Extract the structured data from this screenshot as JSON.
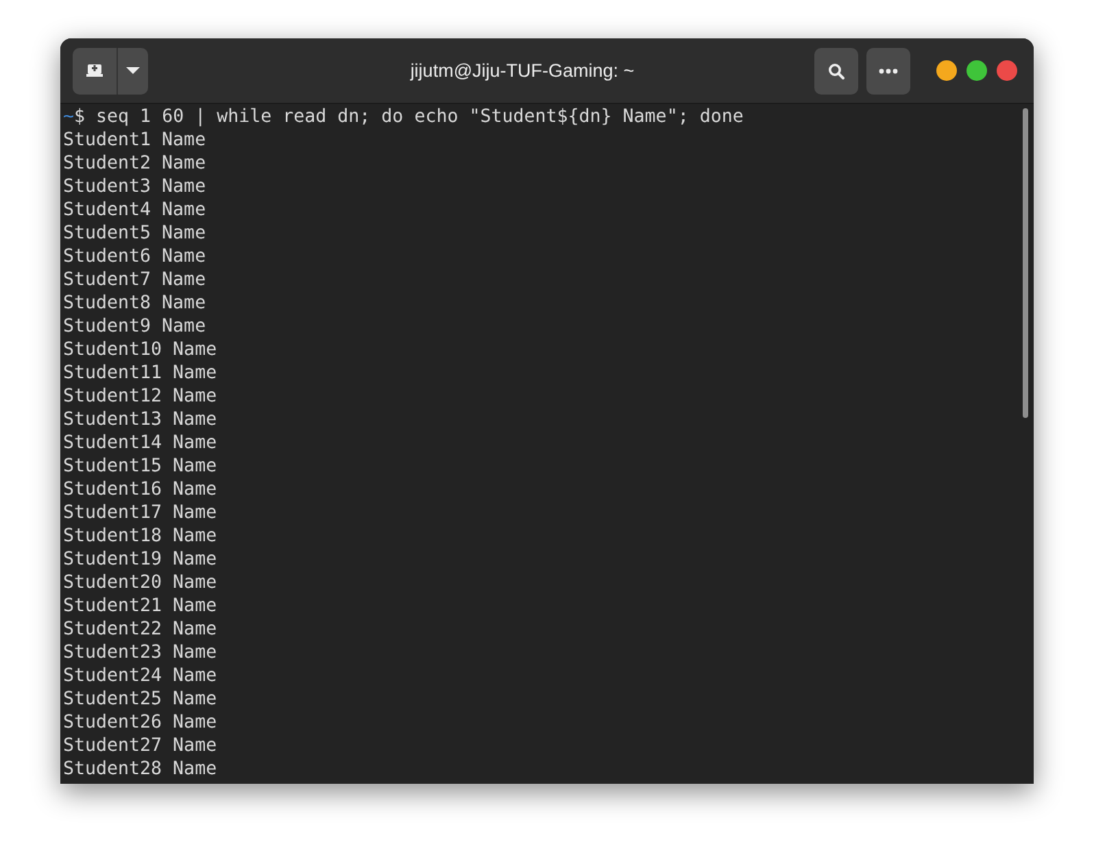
{
  "window": {
    "title": "jijutm@Jiju-TUF-Gaming: ~"
  },
  "terminal": {
    "prompt": {
      "path": "~",
      "symbol": "$",
      "command": " seq 1 60 | while read dn; do echo \"Student${dn} Name\"; done"
    },
    "output": [
      "Student1 Name",
      "Student2 Name",
      "Student3 Name",
      "Student4 Name",
      "Student5 Name",
      "Student6 Name",
      "Student7 Name",
      "Student8 Name",
      "Student9 Name",
      "Student10 Name",
      "Student11 Name",
      "Student12 Name",
      "Student13 Name",
      "Student14 Name",
      "Student15 Name",
      "Student16 Name",
      "Student17 Name",
      "Student18 Name",
      "Student19 Name",
      "Student20 Name",
      "Student21 Name",
      "Student22 Name",
      "Student23 Name",
      "Student24 Name",
      "Student25 Name",
      "Student26 Name",
      "Student27 Name",
      "Student28 Name"
    ]
  }
}
